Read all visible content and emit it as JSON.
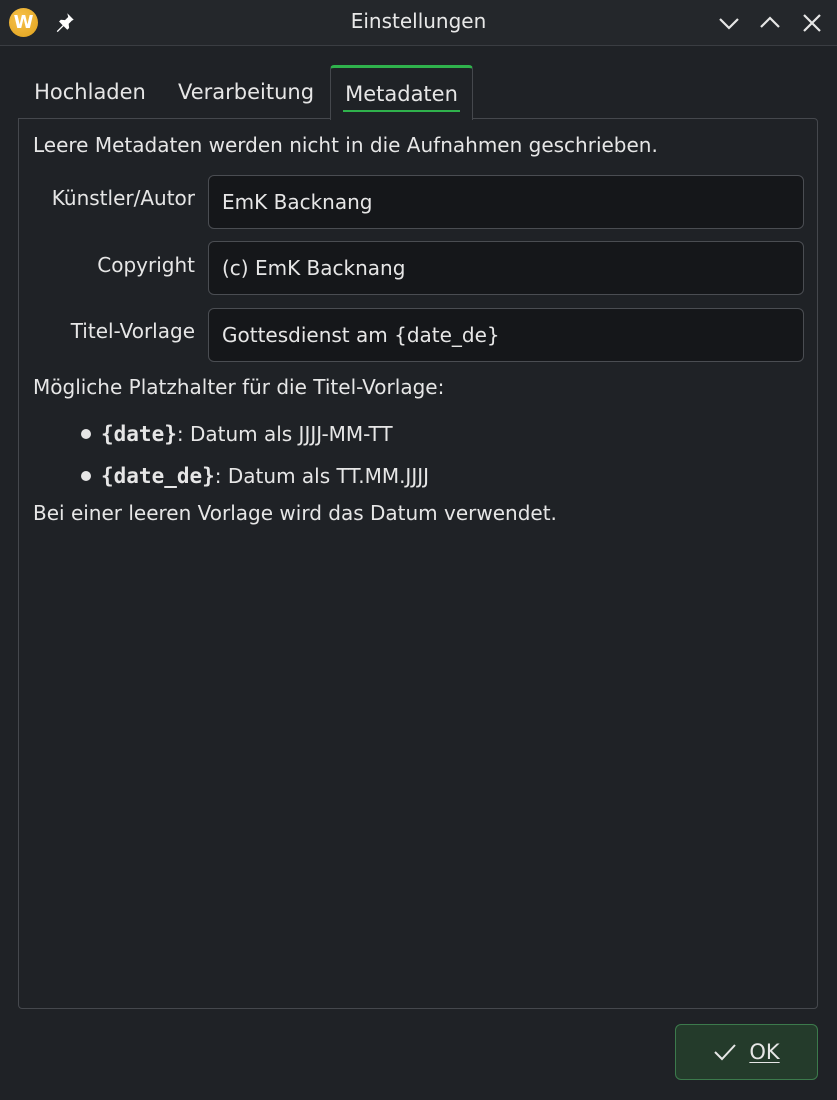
{
  "window": {
    "title": "Einstellungen",
    "logo_letter": "W",
    "logo_color": "#e8a824"
  },
  "titlebar_icons": {
    "pin": "pin-icon",
    "minimize": "chevron-down-icon",
    "maximize": "chevron-up-icon",
    "close": "close-icon"
  },
  "tabs": [
    {
      "label": "Hochladen",
      "active": false
    },
    {
      "label": "Verarbeitung",
      "active": false
    },
    {
      "label": "Metadaten",
      "active": true
    }
  ],
  "accent_color": "#2fb24c",
  "metadata": {
    "info": "Leere Metadaten werden nicht in die Aufnahmen geschrieben.",
    "fields": [
      {
        "label": "Künstler/Autor",
        "value": "EmK Backnang"
      },
      {
        "label": "Copyright",
        "value": "(c) EmK Backnang"
      },
      {
        "label": "Titel-Vorlage",
        "value": "Gottesdienst am {date_de}"
      }
    ],
    "placeholder_heading": "Mögliche Platzhalter für die Titel-Vorlage:",
    "placeholders": [
      {
        "code": "{date}",
        "description": ": Datum als JJJJ-MM-TT"
      },
      {
        "code": "{date_de}",
        "description": ": Datum als TT.MM.JJJJ"
      }
    ],
    "footer": "Bei einer leeren Vorlage wird das Datum verwendet."
  },
  "buttons": {
    "ok_label": "OK",
    "ok_icon": "check-icon"
  }
}
